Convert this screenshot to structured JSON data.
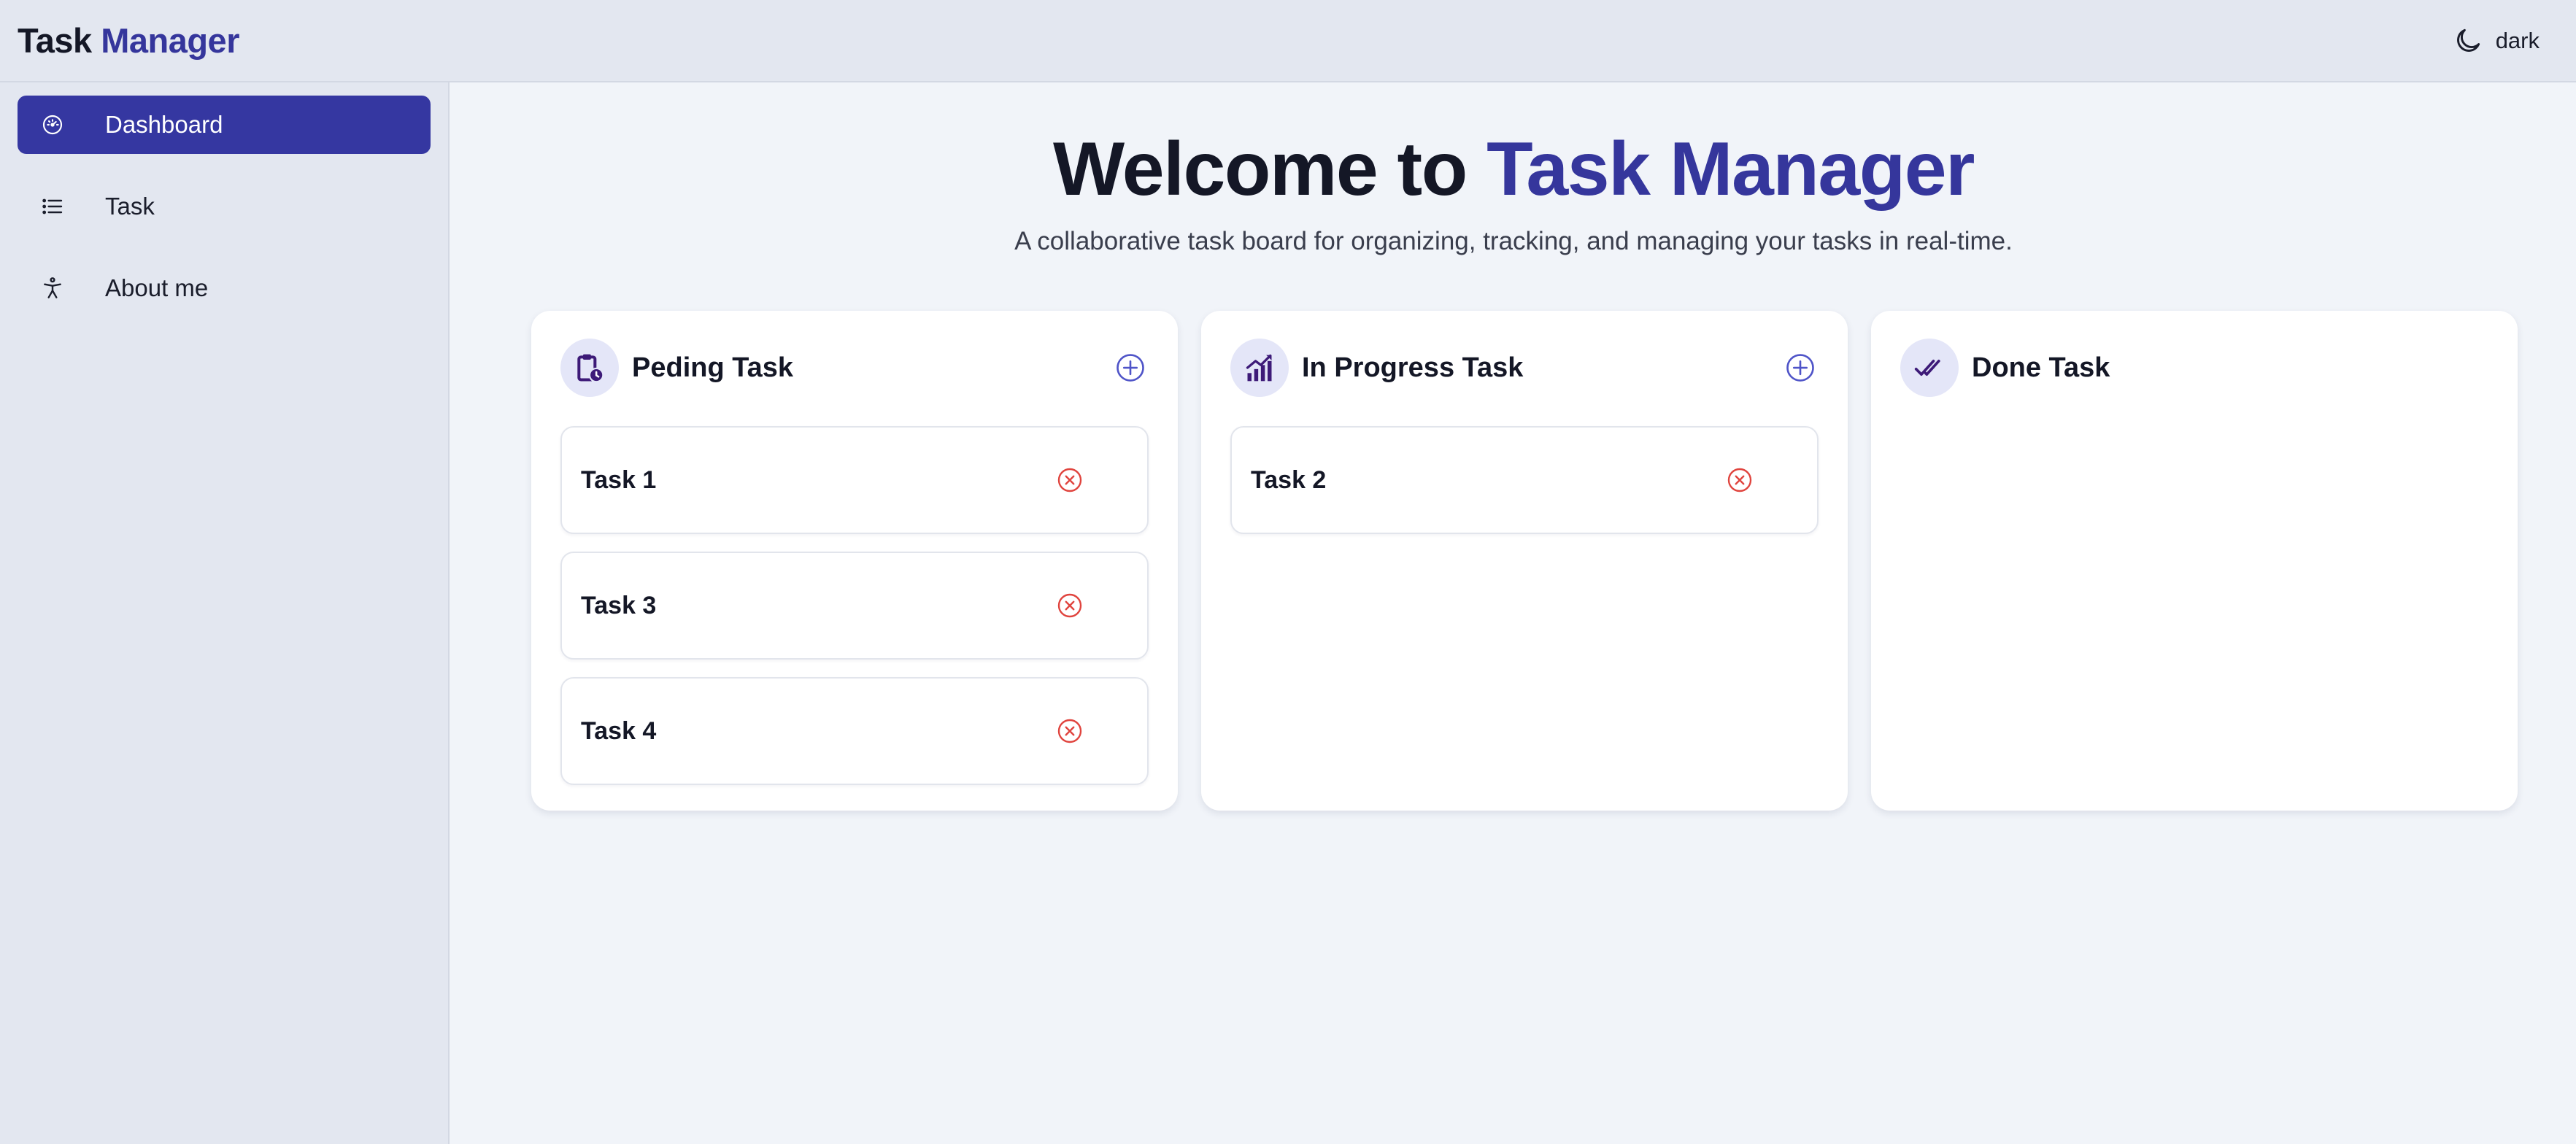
{
  "header": {
    "brand_part1": "Task",
    "brand_part2": "Manager",
    "theme_label": "dark"
  },
  "sidebar": {
    "items": [
      {
        "label": "Dashboard",
        "icon": "dashboard-icon",
        "active": true
      },
      {
        "label": "Task",
        "icon": "list-icon",
        "active": false
      },
      {
        "label": "About me",
        "icon": "accessibility-icon",
        "active": false
      }
    ]
  },
  "main": {
    "welcome_prefix": "Welcome to",
    "welcome_accent": "Task Manager",
    "subtitle": "A collaborative task board for organizing, tracking, and managing your tasks in real-time."
  },
  "columns": [
    {
      "title": "Peding Task",
      "icon": "clipboard-clock-icon",
      "tasks": [
        "Task 1",
        "Task 3",
        "Task 4"
      ]
    },
    {
      "title": "In Progress Task",
      "icon": "chart-trend-icon",
      "tasks": [
        "Task 2"
      ]
    },
    {
      "title": "Done Task",
      "icon": "double-check-icon",
      "tasks": []
    }
  ],
  "colors": {
    "accent": "#35369c",
    "delete": "#e0443e",
    "add": "#4f54c8",
    "icon_purple": "#3d1a78"
  }
}
